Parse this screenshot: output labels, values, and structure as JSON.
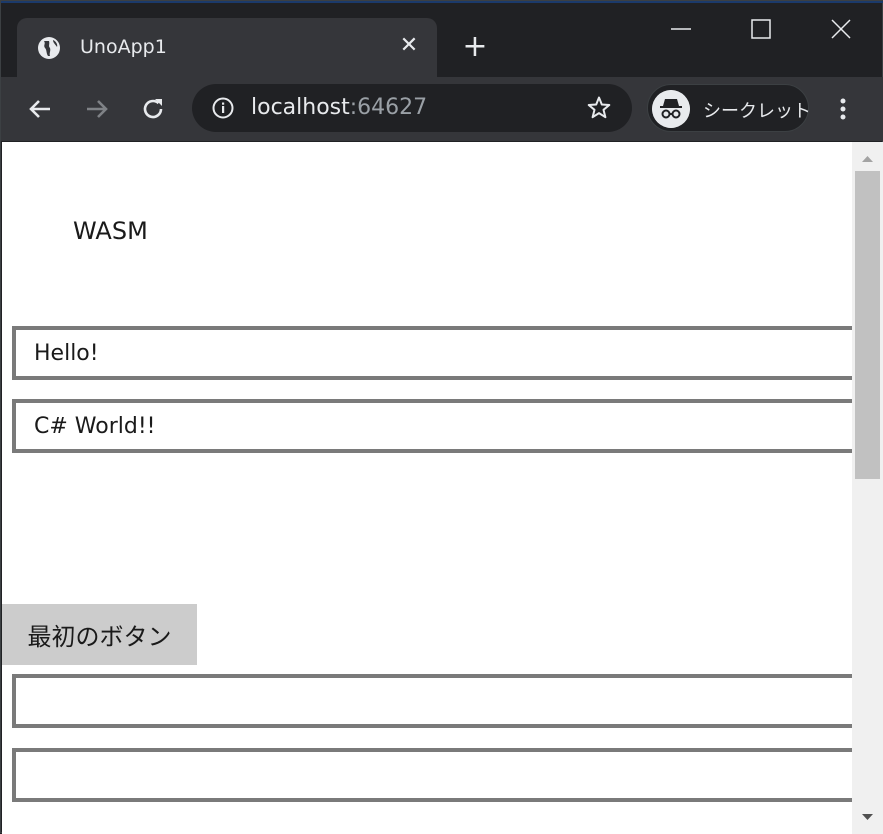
{
  "browser": {
    "tab_title": "UnoApp1",
    "tab_close": "✕",
    "new_tab": "+",
    "url_host": "localhost",
    "url_port": ":64627",
    "profile_label": "シークレット"
  },
  "page": {
    "heading": "WASM",
    "textbox1_value": "Hello!",
    "textbox2_value": "C# World!!",
    "button_label": "最初のボタン",
    "textbox3_value": "",
    "textbox4_value": ""
  },
  "icons": [
    "globe-icon",
    "close-icon",
    "plus-icon",
    "minimize-icon",
    "maximize-icon",
    "window-close-icon",
    "back-arrow-icon",
    "forward-arrow-icon",
    "reload-icon",
    "info-icon",
    "star-icon",
    "incognito-icon",
    "kebab-menu-icon"
  ],
  "colors": {
    "chrome_dark": "#202124",
    "chrome_tab": "#35363a",
    "textbox_border": "#7a7a7a",
    "button_bg": "#cccccc"
  }
}
